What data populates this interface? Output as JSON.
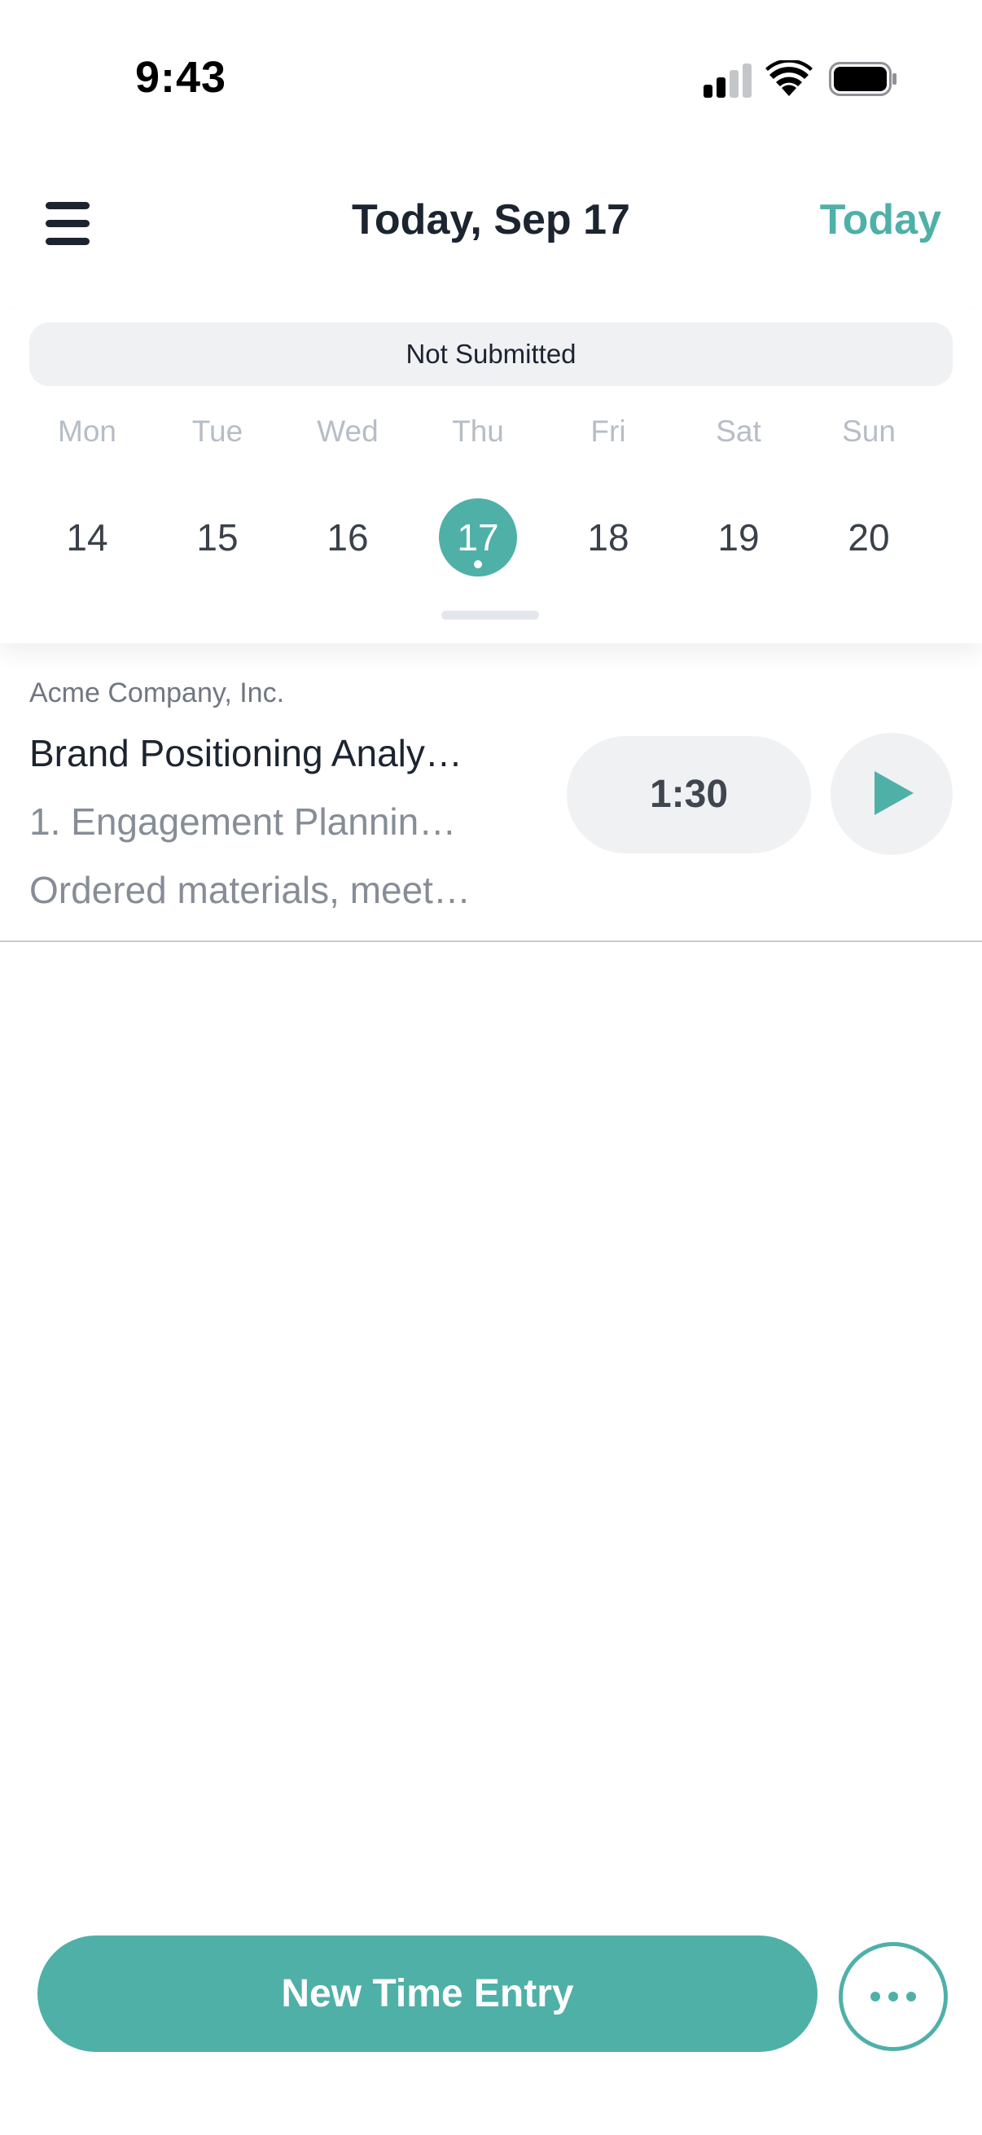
{
  "status_bar": {
    "time": "9:43",
    "icons": [
      "signal-icon",
      "wifi-icon",
      "battery-icon"
    ]
  },
  "header": {
    "menu_icon": "hamburger-menu-icon",
    "title": "Today, Sep 17",
    "today_label": "Today"
  },
  "week": {
    "status": "Not Submitted",
    "weekdays": [
      "Mon",
      "Tue",
      "Wed",
      "Thu",
      "Fri",
      "Sat",
      "Sun"
    ],
    "dates": [
      "14",
      "15",
      "16",
      "17",
      "18",
      "19",
      "20"
    ],
    "selected": "17"
  },
  "entry": {
    "company": "Acme Company, Inc.",
    "project": "Brand Positioning Analy…",
    "task": "1. Engagement Plannin…",
    "notes": "Ordered materials, meet…",
    "duration": "1:30",
    "play_icon": "play-icon"
  },
  "footer": {
    "new_entry_label": "New Time Entry",
    "more_icon": "more-dots-icon"
  },
  "colors": {
    "accent": "#4fb0a8",
    "text": "#1c2430",
    "muted": "#868d97",
    "pill_bg": "#f0f1f3"
  }
}
